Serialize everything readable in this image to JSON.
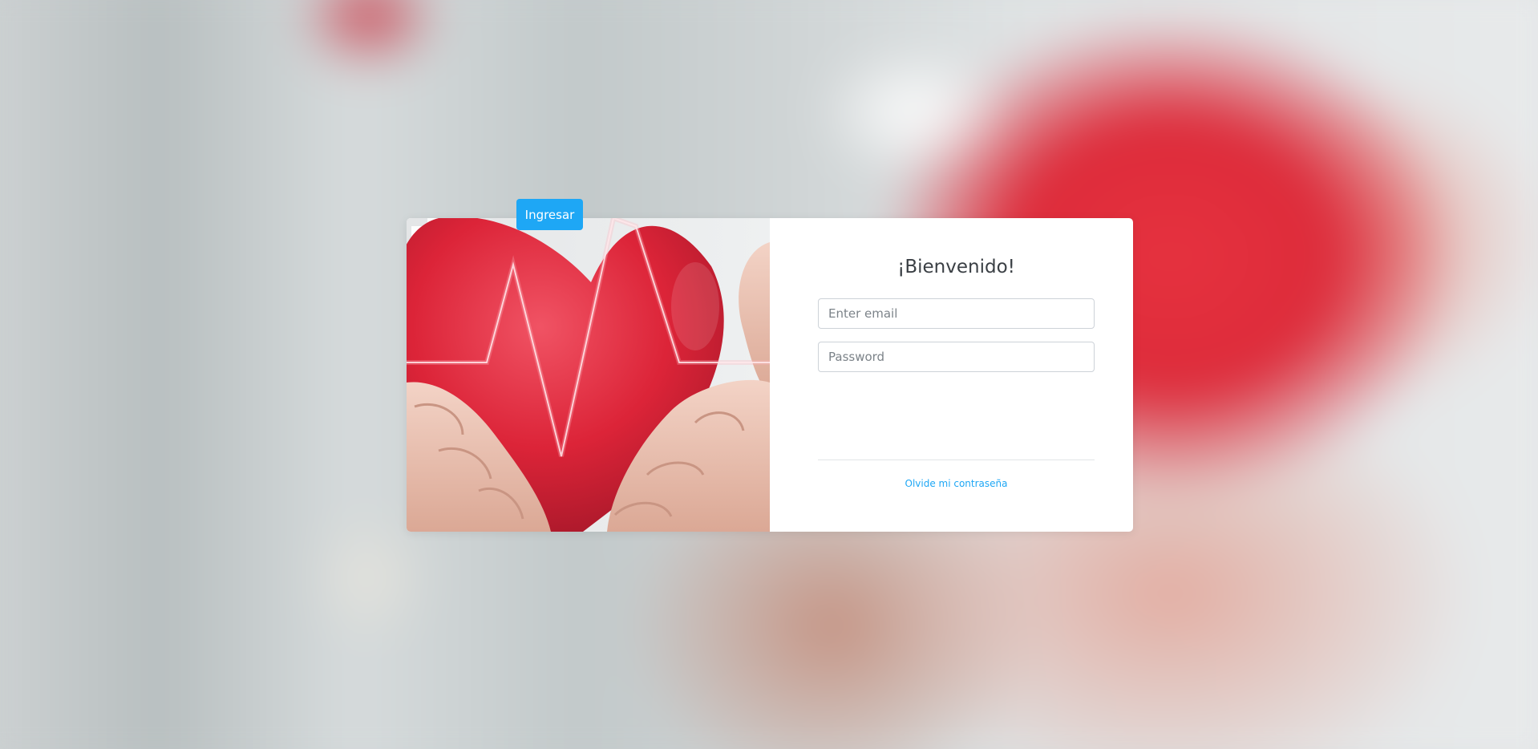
{
  "page": {
    "background": "blurred-heart-hands-photo"
  },
  "login": {
    "image": "heart-in-hands-photo",
    "title": "¡Bienvenido!",
    "email_placeholder": "Enter email",
    "password_placeholder": "Password",
    "submit_label": "Ingresar",
    "forgot_label": "Olvide mi contraseña"
  },
  "colors": {
    "accent": "#1ea7f5",
    "heart": "#dd2b3a",
    "title_text": "#3a3f44"
  }
}
